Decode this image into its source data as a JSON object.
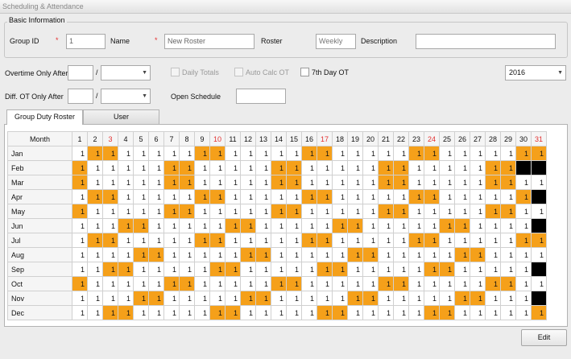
{
  "window": {
    "title": "Scheduling & Attendance"
  },
  "basic_info": {
    "legend": "Basic Information",
    "group_id_label": "Group ID",
    "group_id_value": "1",
    "name_label": "Name",
    "name_value": "New Roster",
    "roster_label": "Roster",
    "roster_value": "Weekly",
    "description_label": "Description",
    "description_value": "",
    "required_mark": "*"
  },
  "options": {
    "overtime_label": "Overtime Only After",
    "diff_ot_label": "Diff. OT Only After",
    "separator": "/",
    "daily_totals_label": "Daily Totals",
    "auto_calc_label": "Auto Calc OT",
    "seventh_day_label": "7th Day OT",
    "open_schedule_label": "Open Schedule",
    "year_value": "2016"
  },
  "tabs": [
    {
      "label": "Group Duty Roster",
      "active": true
    },
    {
      "label": "User",
      "active": false
    }
  ],
  "roster": {
    "month_header": "Month",
    "days": [
      "1",
      "2",
      "3",
      "4",
      "5",
      "6",
      "7",
      "8",
      "9",
      "10",
      "11",
      "12",
      "13",
      "14",
      "15",
      "16",
      "17",
      "18",
      "19",
      "20",
      "21",
      "22",
      "23",
      "24",
      "25",
      "26",
      "27",
      "28",
      "29",
      "30",
      "31"
    ],
    "highlighted_days": [
      3,
      10,
      17,
      24,
      31
    ],
    "accent_color": "#f5a01a",
    "months": [
      {
        "name": "Jan",
        "cells": "1OO11111OO11111OO11111OO11111OO"
      },
      {
        "name": "Feb",
        "cells": "O11111OO11111OO11111OO11111OOBB"
      },
      {
        "name": "Mar",
        "cells": "O11111OO11111OO11111OO11111OO11"
      },
      {
        "name": "Apr",
        "cells": "1OO11111OO11111OO11111OO11111OB"
      },
      {
        "name": "May",
        "cells": "O11111OO11111OO11111OO11111OO11"
      },
      {
        "name": "Jun",
        "cells": "111OO11111OO11111OO11111OO1111B"
      },
      {
        "name": "Jul",
        "cells": "1OO11111OO11111OO11111OO11111OO"
      },
      {
        "name": "Aug",
        "cells": "1111OO11111OO11111OO11111OO1111"
      },
      {
        "name": "Sep",
        "cells": "11OO11111OO11111OO11111OO11111B"
      },
      {
        "name": "Oct",
        "cells": "O11111OO11111OO11111OO11111OO11"
      },
      {
        "name": "Nov",
        "cells": "1111OO11111OO11111OO11111OO111B"
      },
      {
        "name": "Dec",
        "cells": "11OO11111OO11111OO11111OO11111O"
      }
    ]
  },
  "buttons": {
    "edit": "Edit"
  }
}
